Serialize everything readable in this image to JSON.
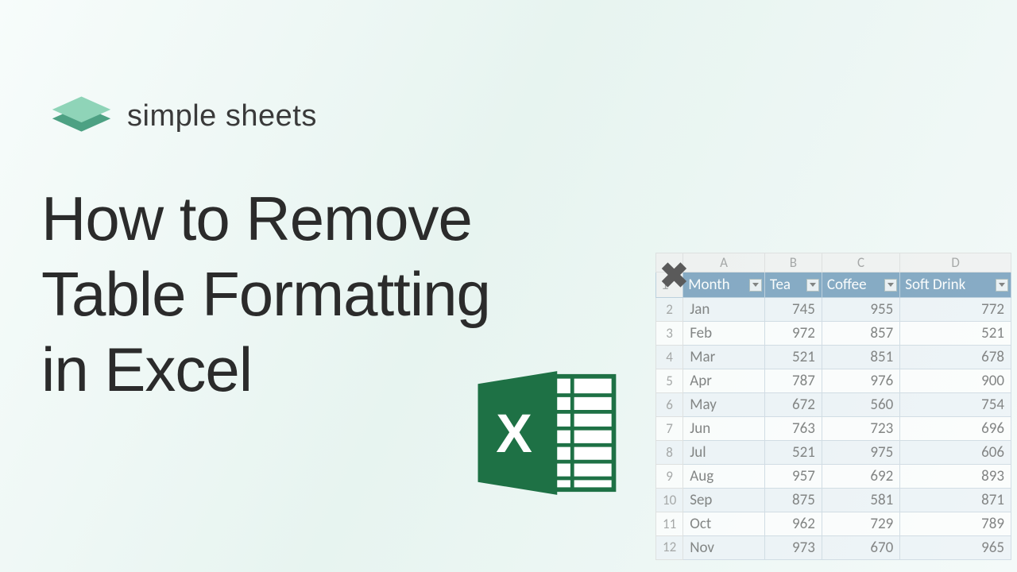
{
  "logo": {
    "text": "simple sheets"
  },
  "headline": "How to Remove\nTable Formatting\nin Excel",
  "icons": {
    "close": "close-icon",
    "excel": "excel-icon",
    "logo_stack": "stacked-layers-icon"
  },
  "sheet": {
    "colLabels": [
      "",
      "A",
      "B",
      "C",
      "D"
    ],
    "headers": [
      "Month",
      "Tea",
      "Coffee",
      "Soft Drink"
    ],
    "rows": [
      {
        "n": 2,
        "month": "Jan",
        "tea": 745,
        "coffee": 955,
        "soft": 772
      },
      {
        "n": 3,
        "month": "Feb",
        "tea": 972,
        "coffee": 857,
        "soft": 521
      },
      {
        "n": 4,
        "month": "Mar",
        "tea": 521,
        "coffee": 851,
        "soft": 678
      },
      {
        "n": 5,
        "month": "Apr",
        "tea": 787,
        "coffee": 976,
        "soft": 900
      },
      {
        "n": 6,
        "month": "May",
        "tea": 672,
        "coffee": 560,
        "soft": 754
      },
      {
        "n": 7,
        "month": "Jun",
        "tea": 763,
        "coffee": 723,
        "soft": 696
      },
      {
        "n": 8,
        "month": "Jul",
        "tea": 521,
        "coffee": 975,
        "soft": 606
      },
      {
        "n": 9,
        "month": "Aug",
        "tea": 957,
        "coffee": 692,
        "soft": 893
      },
      {
        "n": 10,
        "month": "Sep",
        "tea": 875,
        "coffee": 581,
        "soft": 871
      },
      {
        "n": 11,
        "month": "Oct",
        "tea": 962,
        "coffee": 729,
        "soft": 789
      },
      {
        "n": 12,
        "month": "Nov",
        "tea": 973,
        "coffee": 670,
        "soft": 965
      }
    ]
  },
  "colors": {
    "excel_green": "#1e7145",
    "excel_dark": "#0e5c38",
    "table_header": "#5b8bb0",
    "logo_green1": "#7fc8a9",
    "logo_green2": "#4da183"
  }
}
